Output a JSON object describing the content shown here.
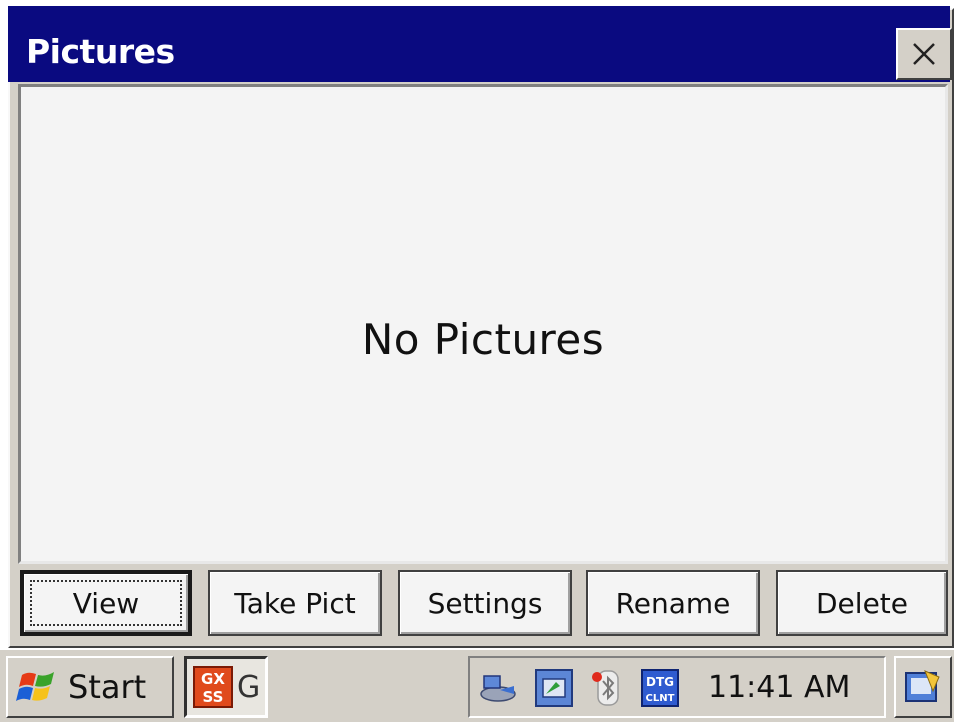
{
  "window": {
    "title": "Pictures",
    "close_icon": "close-icon",
    "title_color": "#0a0a80"
  },
  "content": {
    "empty_message": "No Pictures"
  },
  "buttons": {
    "view": "View",
    "take_pict": "Take Pict",
    "settings": "Settings",
    "rename": "Rename",
    "delete": "Delete"
  },
  "taskbar": {
    "start_label": "Start",
    "start_icon": "windows-flag-icon",
    "task_label": "G",
    "task_icon_text_top": "GX",
    "task_icon_text_bottom": "SS",
    "tray_icons": [
      "network-icon",
      "sync-icon",
      "bluetooth-icon",
      "dtg-client-icon"
    ],
    "dtg_icon_text_top": "DTG",
    "dtg_icon_text_bottom": "CLNT",
    "clock": "11:41 AM",
    "desktop_icon": "show-desktop-icon"
  }
}
